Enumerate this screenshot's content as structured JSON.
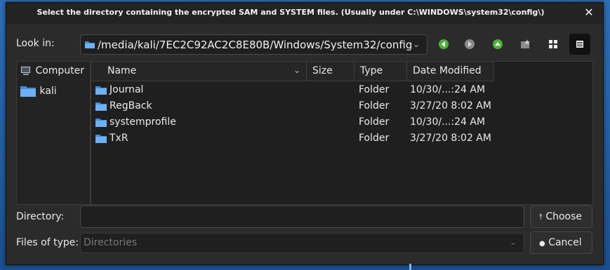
{
  "dialog": {
    "title": "Select the directory containing the encrypted SAM and SYSTEM files. (Usually under C:\\WINDOWS\\system32\\config\\)"
  },
  "look_in": {
    "label": "Look in:",
    "path": "/media/kali/7EC2C92AC2C8E80B/Windows/System32/config"
  },
  "nav": {
    "back_icon": "back-arrow-icon",
    "forward_icon": "forward-arrow-icon",
    "up_icon": "up-arrow-icon",
    "new_folder_icon": "new-folder-icon",
    "list_view_icon": "list-view-icon",
    "detail_view_icon": "detail-view-icon"
  },
  "places": [
    {
      "label": "Computer",
      "icon": "computer-icon"
    },
    {
      "label": "kali",
      "icon": "folder-icon"
    }
  ],
  "columns": {
    "name": "Name",
    "size": "Size",
    "type": "Type",
    "modified": "Date Modified"
  },
  "files": [
    {
      "name": "Journal",
      "size": "",
      "type": "Folder",
      "modified": "10/30/...:24 AM"
    },
    {
      "name": "RegBack",
      "size": "",
      "type": "Folder",
      "modified": "3/27/20 8:02 AM"
    },
    {
      "name": "systemprofile",
      "size": "",
      "type": "Folder",
      "modified": "10/30/...:24 AM"
    },
    {
      "name": "TxR",
      "size": "",
      "type": "Folder",
      "modified": "3/27/20 8:02 AM"
    }
  ],
  "directory": {
    "label": "Directory:",
    "value": ""
  },
  "filetype": {
    "label": "Files of type:",
    "value": "Directories"
  },
  "buttons": {
    "choose": "Choose",
    "cancel": "Cancel"
  },
  "colors": {
    "folder": "#3d8fe0",
    "accent": "#4fb03d"
  }
}
